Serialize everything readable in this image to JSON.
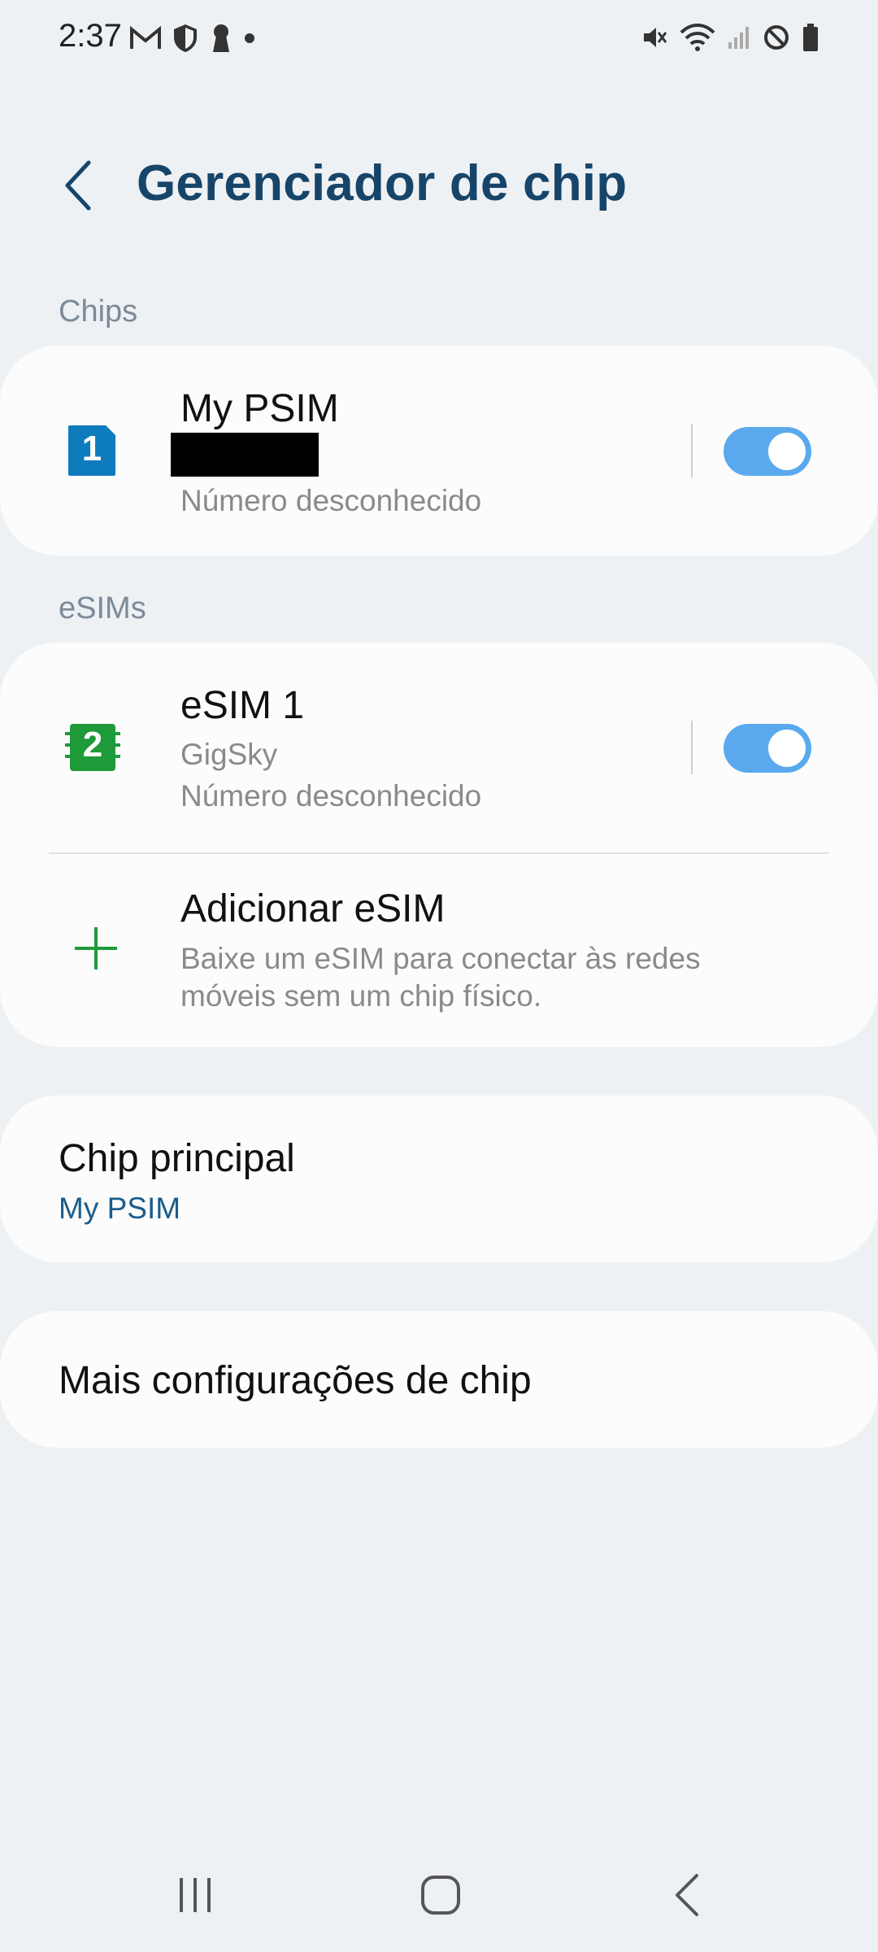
{
  "status_bar": {
    "time": "2:37",
    "left_icons": [
      "gmail-icon",
      "shield-icon",
      "keyhole-icon",
      "dot-icon"
    ],
    "right_icons": [
      "mute-icon",
      "wifi-icon",
      "signal-icon",
      "block-icon",
      "battery-icon"
    ]
  },
  "header": {
    "title": "Gerenciador de chip"
  },
  "sections": {
    "chips_label": "Chips",
    "esims_label": "eSIMs"
  },
  "sims": [
    {
      "badge": "1",
      "name": "My PSIM",
      "number": "Número desconhecido",
      "enabled": true,
      "color": "#0e7bbd"
    },
    {
      "badge": "2",
      "name": "eSIM 1",
      "carrier": "GigSky",
      "number": "Número desconhecido",
      "enabled": true,
      "color": "#1f9a3a"
    }
  ],
  "add_esim": {
    "title": "Adicionar eSIM",
    "desc_line1": "Baixe um eSIM para conectar às redes",
    "desc_line2": "móveis sem um chip físico."
  },
  "primary_chip": {
    "label": "Chip principal",
    "value": "My PSIM"
  },
  "more_settings": {
    "label": "Mais configurações de chip"
  },
  "colors": {
    "accent": "#17456a",
    "toggle": "#5aa9ee",
    "add_plus": "#1f9a3a",
    "background": "#eef1f4"
  }
}
